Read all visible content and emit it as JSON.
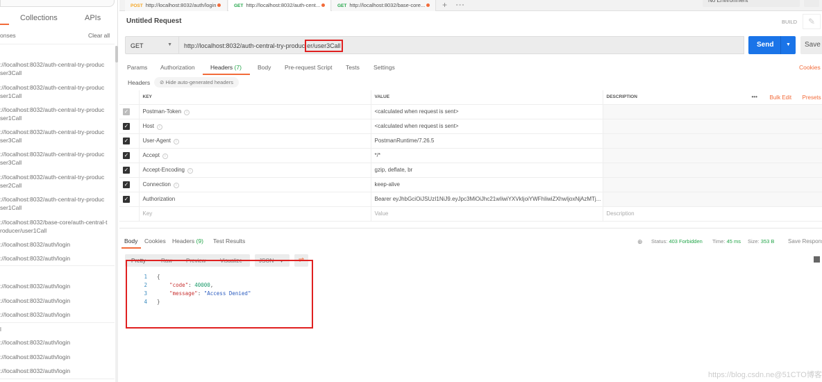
{
  "sidebar": {
    "tabs": [
      "Collections",
      "APIs"
    ],
    "responses_label": "onses",
    "clear_all": "Clear all",
    "items": [
      {
        "l1": "://localhost:8032/auth-central-try-produc",
        "l2": "ser3Call"
      },
      {
        "l1": "://localhost:8032/auth-central-try-produc",
        "l2": "ser1Call"
      },
      {
        "l1": "://localhost:8032/auth-central-try-produc",
        "l2": "ser1Call"
      },
      {
        "l1": "://localhost:8032/auth-central-try-produc",
        "l2": "ser3Call"
      },
      {
        "l1": "://localhost:8032/auth-central-try-produc",
        "l2": "ser3Call"
      },
      {
        "l1": "://localhost:8032/auth-central-try-produc",
        "l2": "ser2Call"
      },
      {
        "l1": "://localhost:8032/auth-central-try-produc",
        "l2": "ser1Call"
      },
      {
        "l1": "://localhost:8032/base-core/auth-central-t",
        "l2": "roducer/user1Call"
      },
      {
        "l1": "://localhost:8032/auth/login"
      },
      {
        "l1": "://localhost:8032/auth/login"
      },
      {
        "l1": "://localhost:8032/auth/login"
      },
      {
        "l1": "://localhost:8032/auth/login"
      },
      {
        "l1": "://localhost:8032/auth/login"
      },
      {
        "l1": "://localhost:8032/auth/login"
      },
      {
        "l1": "://localhost:8032/auth/login"
      },
      {
        "l1": "://localhost:8032/auth/login"
      }
    ],
    "group_label": "l"
  },
  "tabs": [
    {
      "method": "POST",
      "url": "http://localhost:8032/auth/login",
      "color": "#f5a623"
    },
    {
      "method": "GET",
      "url": "http://localhost:8032/auth-cent...",
      "color": "#23a549"
    },
    {
      "method": "GET",
      "url": "http://localhost:8032/base-core...",
      "color": "#23a549"
    }
  ],
  "tab_more": "+",
  "tab_options": "∘∘∘",
  "environment": "No Environment",
  "request": {
    "title": "Untitled Request",
    "build": "BUILD",
    "method": "GET",
    "url_prefix": "http://localhost:8032/auth-central-try-produc",
    "url_boxed": "er/user3Call",
    "send": "Send",
    "save": "Save"
  },
  "config_tabs": [
    {
      "label": "Params"
    },
    {
      "label": "Authorization"
    },
    {
      "label": "Headers",
      "count": "(7)"
    },
    {
      "label": "Body"
    },
    {
      "label": "Pre-request Script"
    },
    {
      "label": "Tests"
    },
    {
      "label": "Settings"
    }
  ],
  "cookies": "Cookies",
  "headers_label": "Headers",
  "hide_auto": "Hide auto-generated headers",
  "table": {
    "cols": [
      "KEY",
      "VALUE",
      "DESCRIPTION"
    ],
    "bulk_edit": "Bulk Edit",
    "presets": "Presets",
    "rows": [
      {
        "key": "Postman-Token",
        "value": "<calculated when request is sent>",
        "checked": true,
        "disabled": true
      },
      {
        "key": "Host",
        "value": "<calculated when request is sent>",
        "checked": true
      },
      {
        "key": "User-Agent",
        "value": "PostmanRuntime/7.26.5",
        "checked": true
      },
      {
        "key": "Accept",
        "value": "*/*",
        "checked": true
      },
      {
        "key": "Accept-Encoding",
        "value": "gzip, deflate, br",
        "checked": true
      },
      {
        "key": "Connection",
        "value": "keep-alive",
        "checked": true
      },
      {
        "key": "Authorization",
        "value": "Bearer eyJhbGciOiJSUzI1NiJ9.eyJpc3MiOiJhc21wIiwiYXVkIjoiYWFhIiwiZXhwIjoxNjAzMTj...",
        "checked": true
      }
    ],
    "placeholders": {
      "key": "Key",
      "value": "Value",
      "description": "Description"
    }
  },
  "response": {
    "tabs": [
      {
        "label": "Body"
      },
      {
        "label": "Cookies"
      },
      {
        "label": "Headers",
        "count": "(9)"
      },
      {
        "label": "Test Results"
      }
    ],
    "status_label": "Status:",
    "status": "403 Forbidden",
    "time_label": "Time:",
    "time": "45 ms",
    "size_label": "Size:",
    "size": "353 B",
    "save": "Save Response",
    "formats": [
      "Pretty",
      "Raw",
      "Preview",
      "Visualize"
    ],
    "lang": "JSON",
    "body": {
      "code": "40000",
      "message": "\"Access Denied\""
    }
  },
  "watermark": "https://blog.csdn.ne@51CTO博客"
}
